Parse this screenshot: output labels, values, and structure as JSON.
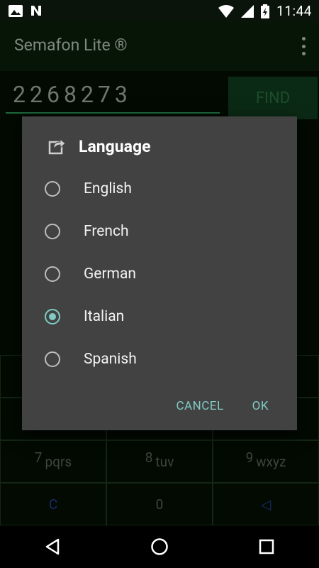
{
  "status_bar": {
    "time": "11:44",
    "icons": [
      "image-icon",
      "notification-n-icon",
      "wifi-icon",
      "signal-icon",
      "battery-charging-icon"
    ]
  },
  "app_bar": {
    "title": "Semafon Lite ®",
    "overflow_icon": "more-vert-icon"
  },
  "main": {
    "number": "2268273",
    "find_label": "FIND",
    "keypad": [
      {
        "num": "7",
        "letters": "pqrs"
      },
      {
        "num": "8",
        "letters": "tuv"
      },
      {
        "num": "9",
        "letters": "wxyz"
      },
      {
        "num": "",
        "letters": "C"
      },
      {
        "num": "",
        "letters": "0"
      },
      {
        "num": "",
        "letters": "◁"
      }
    ]
  },
  "dialog": {
    "title": "Language",
    "icon": "edit-icon",
    "options": [
      {
        "label": "English",
        "checked": false
      },
      {
        "label": "French",
        "checked": false
      },
      {
        "label": "German",
        "checked": false
      },
      {
        "label": "Italian",
        "checked": true
      },
      {
        "label": "Spanish",
        "checked": false
      }
    ],
    "cancel_label": "CANCEL",
    "ok_label": "OK",
    "accent_color": "#80cbc4"
  },
  "nav_bar": {
    "icons": [
      "back-icon",
      "home-icon",
      "recents-icon"
    ]
  }
}
